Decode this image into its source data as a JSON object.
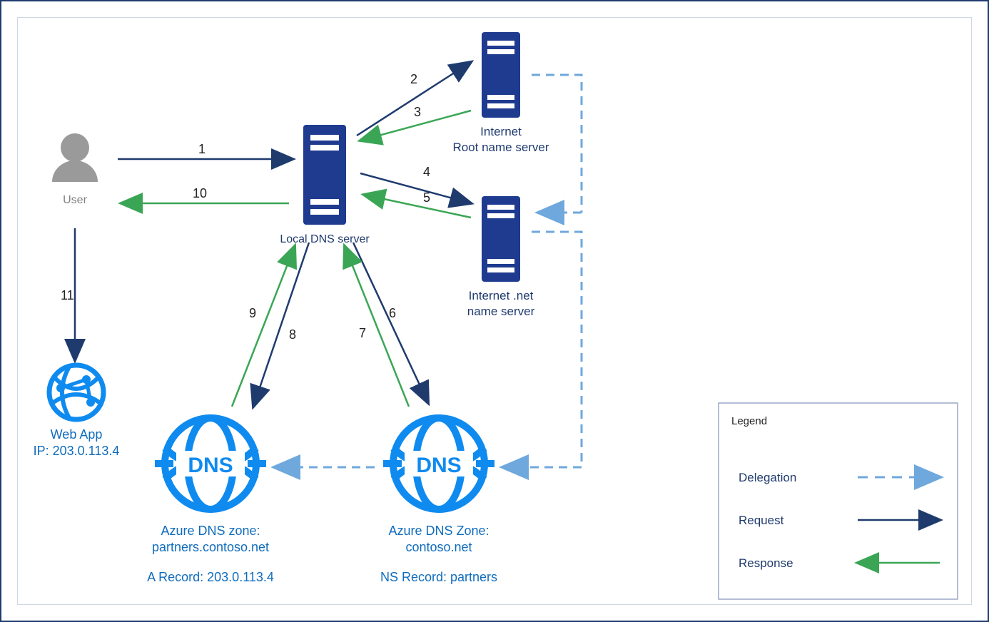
{
  "nodes": {
    "user": {
      "label": "User"
    },
    "local_dns": {
      "label": "Local DNS server"
    },
    "root": {
      "line1": "Internet",
      "line2": "Root name server"
    },
    "net": {
      "line1": "Internet .net",
      "line2": "name server"
    },
    "webapp": {
      "line1": "Web App",
      "line2": "IP: 203.0.113.4"
    },
    "dns_partners": {
      "line1": "Azure DNS zone:",
      "line2": "partners.contoso.net",
      "record": "A Record: 203.0.113.4"
    },
    "dns_contoso": {
      "line1": "Azure DNS Zone:",
      "line2": "contoso.net",
      "record": "NS Record: partners"
    }
  },
  "steps": {
    "s1": "1",
    "s2": "2",
    "s3": "3",
    "s4": "4",
    "s5": "5",
    "s6": "6",
    "s7": "7",
    "s8": "8",
    "s9": "9",
    "s10": "10",
    "s11": "11"
  },
  "legend": {
    "title": "Legend",
    "delegation": "Delegation",
    "request": "Request",
    "response": "Response"
  }
}
